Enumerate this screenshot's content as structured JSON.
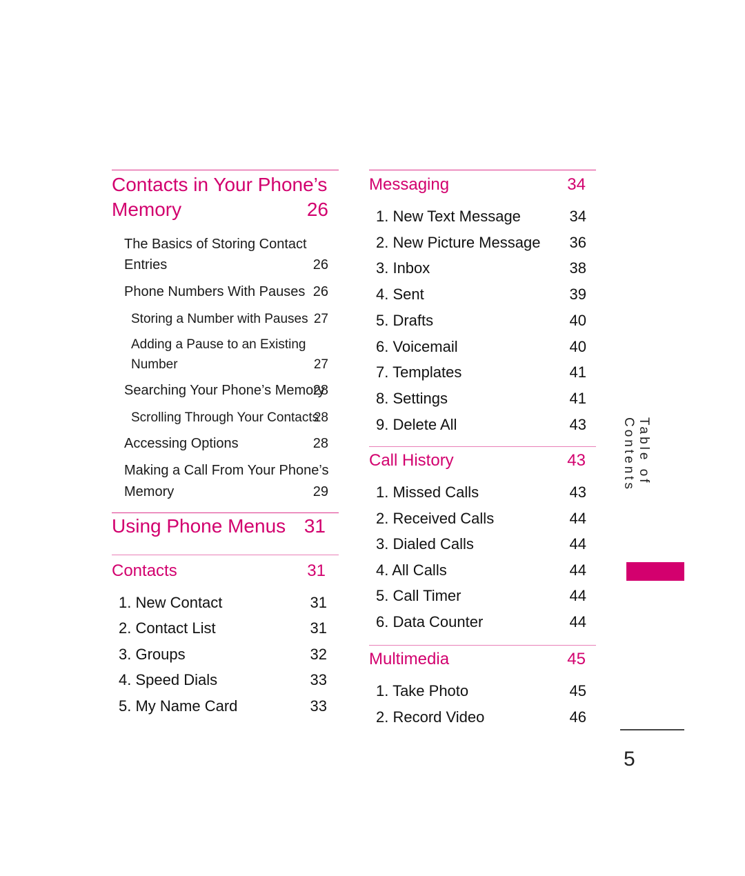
{
  "colors": {
    "accent": "#d2006e",
    "text": "#111111"
  },
  "left_column": {
    "section1": {
      "title_line1": "Contacts in Your Phone’s",
      "title_line2": "Memory",
      "page": "26",
      "entries": [
        {
          "line1": "The Basics of Storing Contact",
          "line2": "Entries",
          "page": "26"
        },
        {
          "line1": "Phone Numbers With Pauses",
          "page": "26"
        },
        {
          "line1": "Storing a Number with Pauses",
          "page": "27"
        },
        {
          "line1": "Adding a Pause to an Existing",
          "line2": "Number",
          "page": "27"
        },
        {
          "line1": "Searching Your Phone’s Memory",
          "page": "28"
        },
        {
          "line1": "Scrolling Through Your Contacts",
          "page": "28"
        },
        {
          "line1": "Accessing Options",
          "page": "28"
        },
        {
          "line1": "Making a Call From Your Phone’s",
          "line2": "Memory",
          "page": "29"
        }
      ]
    },
    "section2": {
      "title": "Using Phone Menus",
      "page": "31"
    },
    "section3": {
      "title": "Contacts",
      "page": "31",
      "items": [
        {
          "label": "1. New Contact",
          "page": "31"
        },
        {
          "label": "2. Contact List",
          "page": "31"
        },
        {
          "label": "3. Groups",
          "page": "32"
        },
        {
          "label": "4. Speed Dials",
          "page": "33"
        },
        {
          "label": "5. My Name Card",
          "page": "33"
        }
      ]
    }
  },
  "right_column": {
    "messaging": {
      "title": "Messaging",
      "page": "34",
      "items": [
        {
          "label": "1. New Text Message",
          "page": "34"
        },
        {
          "label": "2. New Picture Message",
          "page": "36"
        },
        {
          "label": "3. Inbox",
          "page": "38"
        },
        {
          "label": "4. Sent",
          "page": "39"
        },
        {
          "label": "5. Drafts",
          "page": "40"
        },
        {
          "label": "6. Voicemail",
          "page": "40"
        },
        {
          "label": "7. Templates",
          "page": "41"
        },
        {
          "label": "8. Settings",
          "page": "41"
        },
        {
          "label": "9. Delete All",
          "page": "43"
        }
      ]
    },
    "call_history": {
      "title": "Call History",
      "page": "43",
      "items": [
        {
          "label": "1. Missed Calls",
          "page": "43"
        },
        {
          "label": "2. Received Calls",
          "page": "44"
        },
        {
          "label": "3. Dialed Calls",
          "page": "44"
        },
        {
          "label": "4. All Calls",
          "page": "44"
        },
        {
          "label": "5. Call Timer",
          "page": "44"
        },
        {
          "label": "6. Data Counter",
          "page": "44"
        }
      ]
    },
    "multimedia": {
      "title": "Multimedia",
      "page": "45",
      "items": [
        {
          "label": "1. Take Photo",
          "page": "45"
        },
        {
          "label": "2. Record Video",
          "page": "46"
        }
      ]
    }
  },
  "side_tab": {
    "label": "Table of Contents"
  },
  "footer": {
    "page_number": "5"
  }
}
